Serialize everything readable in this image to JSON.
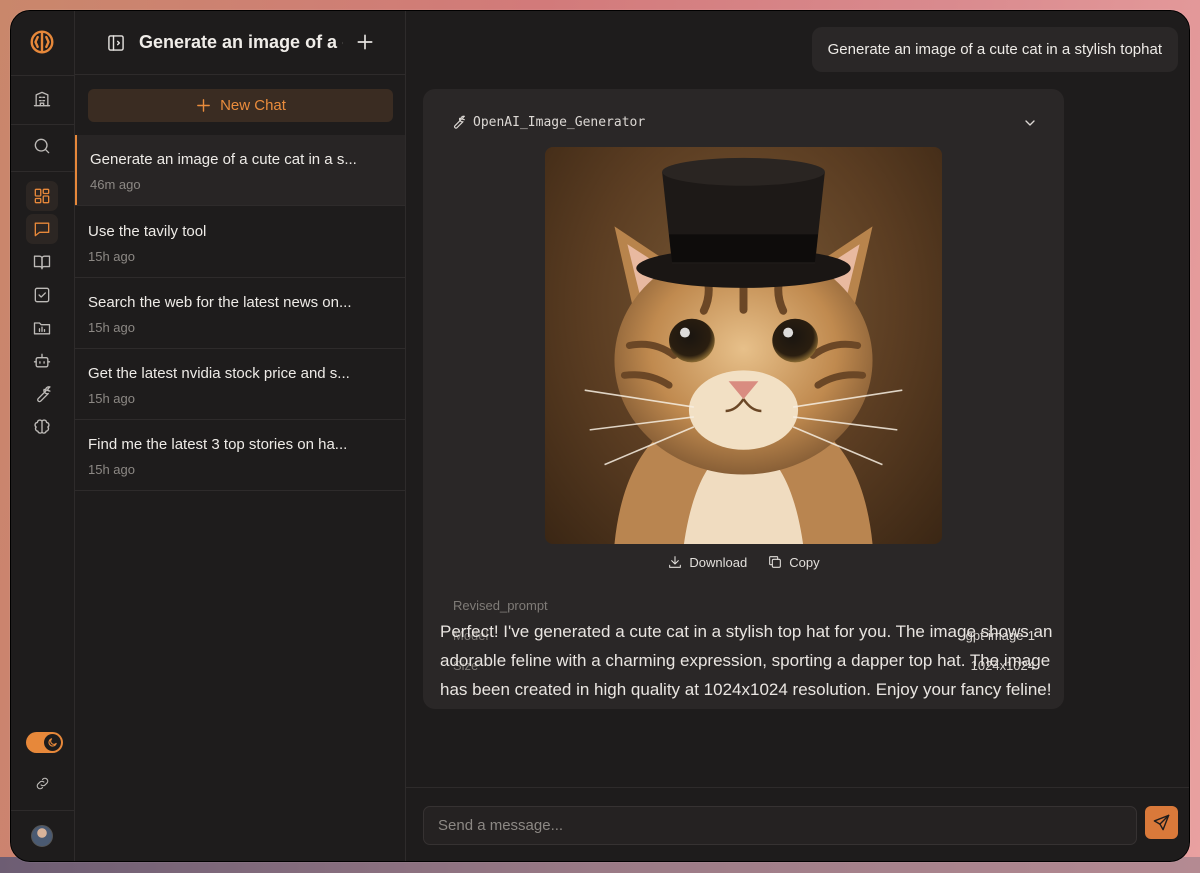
{
  "app": {
    "accent": "#e7883a"
  },
  "sidebar": {
    "title": "Generate an image of a cute cat in a stylish tophat",
    "new_chat_label": "New Chat",
    "chats": [
      {
        "title": "Generate an image of a cute cat in a s...",
        "time": "46m ago",
        "active": true
      },
      {
        "title": "Use the tavily tool",
        "time": "15h ago",
        "active": false
      },
      {
        "title": "Search the web for the latest news on...",
        "time": "15h ago",
        "active": false
      },
      {
        "title": "Get the latest nvidia stock price and s...",
        "time": "15h ago",
        "active": false
      },
      {
        "title": "Find me the latest 3 top stories on ha...",
        "time": "15h ago",
        "active": false
      }
    ]
  },
  "rail": {
    "icons": [
      "logo-icon",
      "building-icon",
      "search-icon",
      "dashboard-icon",
      "chat-icon",
      "book-icon",
      "tasks-icon",
      "folder-chart-icon",
      "bot-icon",
      "wrench-icon",
      "brain-icon",
      "link-icon"
    ],
    "dark_mode": true
  },
  "conversation": {
    "user_message": "Generate an image of a cute cat in a stylish tophat",
    "tool": {
      "name": "OpenAI_Image_Generator",
      "download_label": "Download",
      "copy_label": "Copy",
      "meta": [
        {
          "key": "Revised_prompt",
          "value": ""
        },
        {
          "key": "Model",
          "value": "gpt-image-1"
        },
        {
          "key": "Size",
          "value": "1024x1024"
        }
      ]
    },
    "assistant_message": "Perfect! I've generated a cute cat in a stylish top hat for you. The image shows an adorable feline with a charming expression, sporting a dapper top hat. The image has been created in high quality at 1024x1024 resolution. Enjoy your fancy feline!"
  },
  "composer": {
    "placeholder": "Send a message..."
  }
}
